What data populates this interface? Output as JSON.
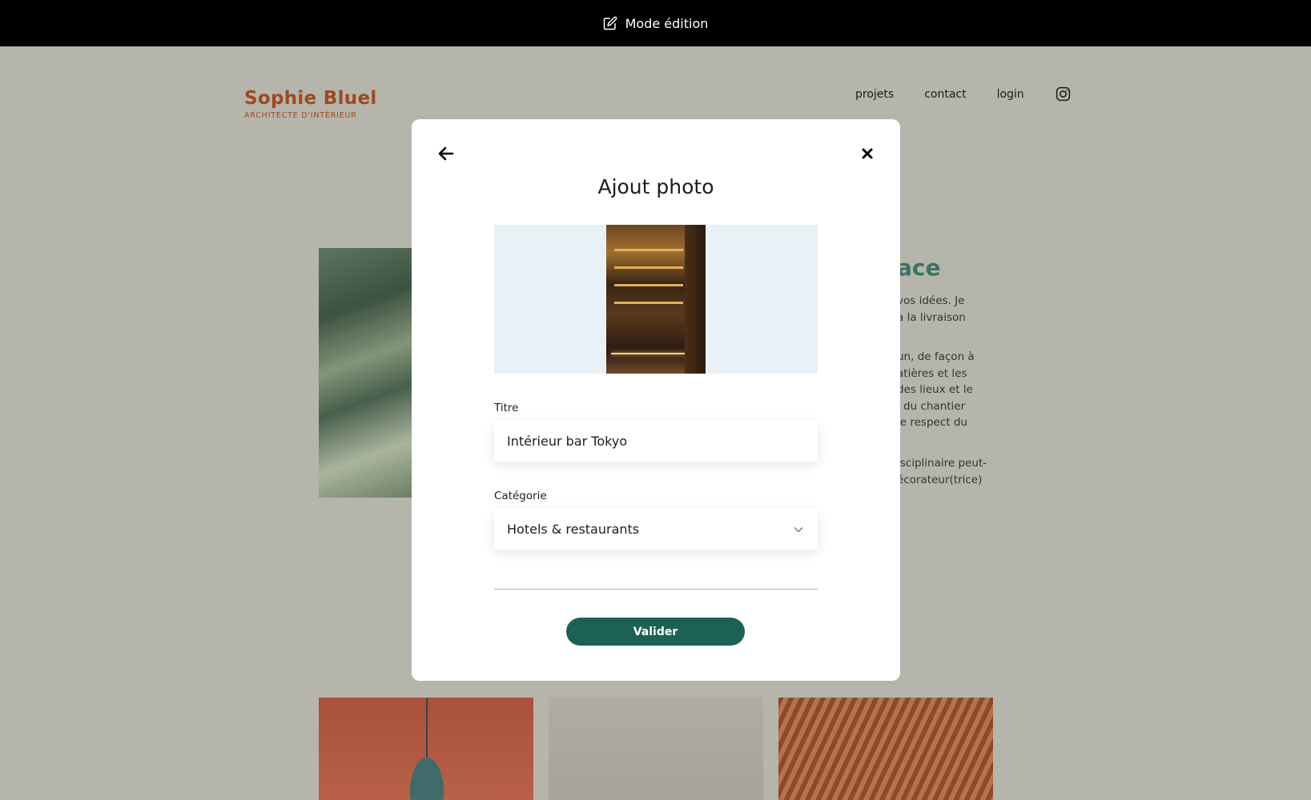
{
  "edit_bar": {
    "label": "Mode édition",
    "icon": "edit-icon"
  },
  "header": {
    "logo_name": "Sophie Bluel",
    "logo_subtitle": "ARCHITECTE D'INTÉRIEUR",
    "nav": [
      "projets",
      "contact",
      "login"
    ],
    "social_icon": "instagram-icon"
  },
  "background": {
    "title_fragment": "ace",
    "text_block_1": [
      "vos idées. Je",
      "à la livraison"
    ],
    "text_block_2": [
      "un, de façon à",
      "atières et les",
      "des lieux et le",
      "i du chantier",
      "le respect du"
    ],
    "text_block_3": [
      "isciplinaire peut-",
      "écorateur(trice)"
    ]
  },
  "modal": {
    "title": "Ajout photo",
    "back_icon": "arrow-left-icon",
    "close_icon": "close-icon",
    "title_label": "Titre",
    "title_value": "Intérieur bar Tokyo",
    "category_label": "Catégorie",
    "category_value": "Hotels & restaurants",
    "submit_label": "Valider"
  },
  "colors": {
    "brand": "#9c4a22",
    "accent": "#1d6154",
    "overlay_bg": "#b5b5ab",
    "preview_bg": "#e8f1f6"
  }
}
